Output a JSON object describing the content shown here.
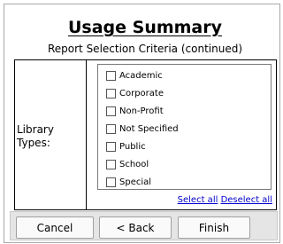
{
  "header": {
    "title": "Usage Summary",
    "subtitle": "Report Selection Criteria (continued)"
  },
  "criteria": {
    "library_types_label": "Library Types:",
    "options": [
      {
        "label": "Academic",
        "checked": false
      },
      {
        "label": "Corporate",
        "checked": false
      },
      {
        "label": "Non-Profit",
        "checked": false
      },
      {
        "label": "Not Specified",
        "checked": false
      },
      {
        "label": "Public",
        "checked": false
      },
      {
        "label": "School",
        "checked": false
      },
      {
        "label": "Special",
        "checked": false
      }
    ],
    "select_all": "Select all",
    "deselect_all": "Deselect all"
  },
  "footer": {
    "cancel": "Cancel",
    "back": "< Back",
    "finish": "Finish"
  },
  "colors": {
    "link": "#0000cc",
    "footer_bg": "#e5e5e5"
  }
}
